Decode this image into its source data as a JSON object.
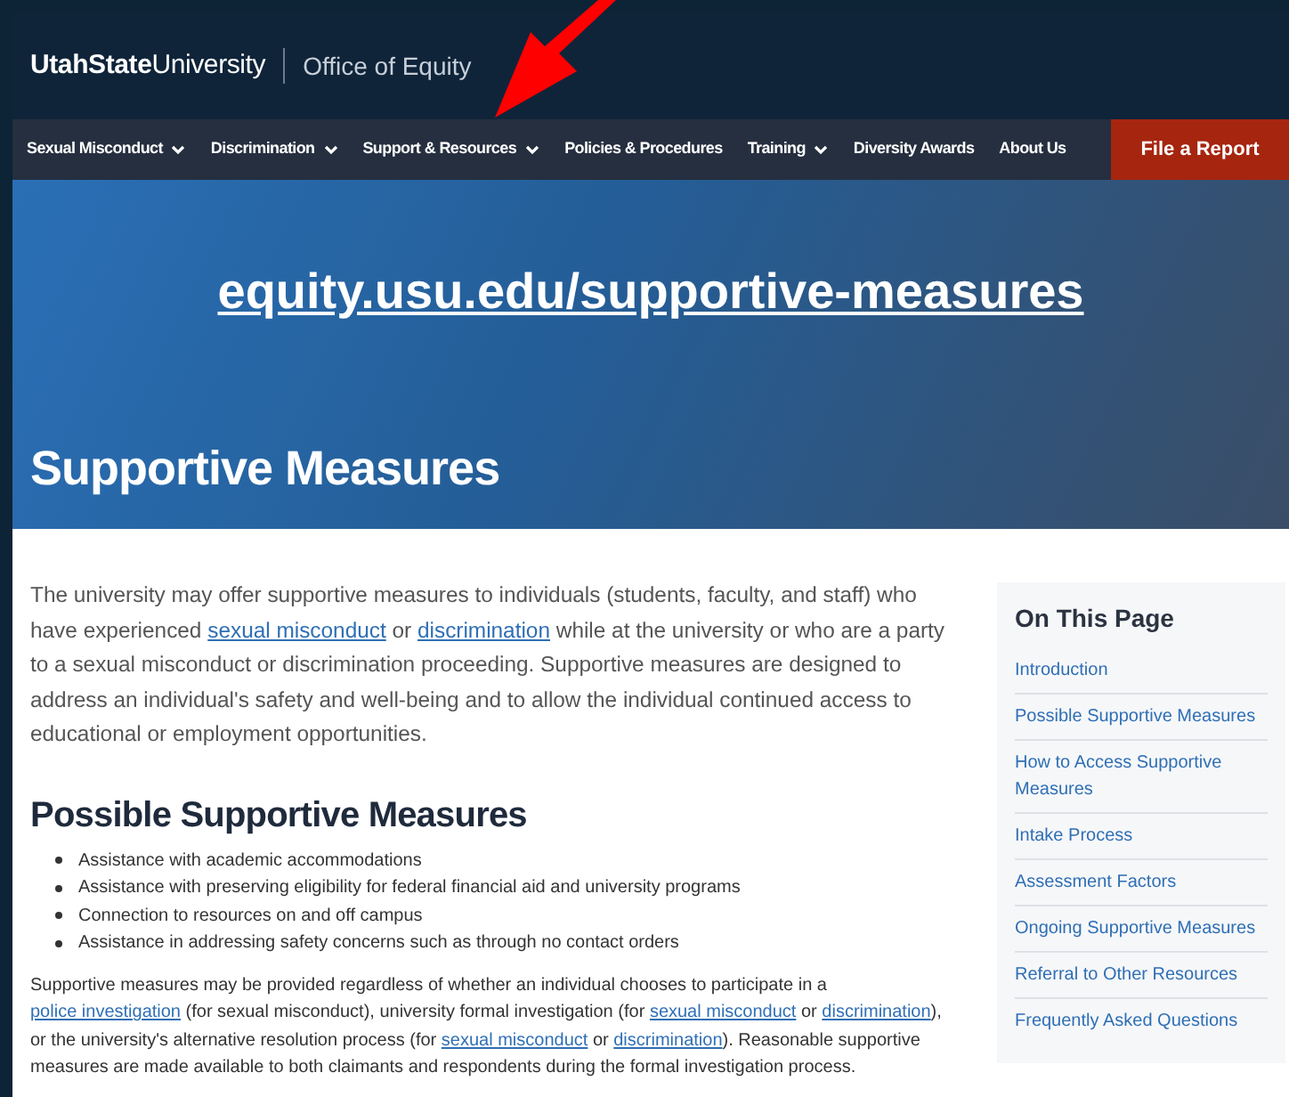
{
  "header": {
    "logo_bold": "UtahState",
    "logo_regular": "University",
    "department": "Office of Equity"
  },
  "annotation_arrow": {
    "color": "#ff0000"
  },
  "nav": {
    "items": [
      {
        "label": "Sexual Misconduct",
        "dropdown": true
      },
      {
        "label": "Discrimination",
        "dropdown": true
      },
      {
        "label": "Support & Resources",
        "dropdown": true
      },
      {
        "label": "Policies & Procedures",
        "dropdown": false
      },
      {
        "label": "Training",
        "dropdown": true
      },
      {
        "label": "Diversity Awards",
        "dropdown": false
      },
      {
        "label": "About Us",
        "dropdown": false
      }
    ],
    "cta": "File a Report"
  },
  "hero": {
    "url": "equity.usu.edu/supportive-measures",
    "title": "Supportive Measures"
  },
  "intro": [
    {
      "kind": "text",
      "text": "The university may offer supportive measures to individuals (students, faculty, and staff) who have experienced "
    },
    {
      "kind": "link",
      "text": "sexual misconduct"
    },
    {
      "kind": "text",
      "text": " or "
    },
    {
      "kind": "link",
      "text": "discrimination"
    },
    {
      "kind": "text",
      "text": " while at the university or who are a party to a sexual misconduct or discrimination proceeding. Supportive measures are designed to address an individual's safety and well-being and to allow the individual continued access to educational or employment opportunities."
    }
  ],
  "section": {
    "heading": "Possible Supportive Measures",
    "bullets": [
      "Assistance with academic accommodations",
      "Assistance with preserving eligibility for federal financial aid and university programs",
      "Connection to resources on and off campus",
      "Assistance in addressing safety concerns such as through no contact orders"
    ],
    "paragraph": [
      {
        "kind": "text",
        "text": "Supportive measures may be provided regardless of whether an individual chooses to participate in a "
      },
      {
        "kind": "link",
        "text": "police investigation"
      },
      {
        "kind": "text",
        "text": " (for sexual misconduct), university formal investigation (for "
      },
      {
        "kind": "link",
        "text": "sexual misconduct"
      },
      {
        "kind": "text",
        "text": " or "
      },
      {
        "kind": "link",
        "text": "discrimination"
      },
      {
        "kind": "text",
        "text": "), or the university's alternative resolution process (for "
      },
      {
        "kind": "link",
        "text": "sexual misconduct"
      },
      {
        "kind": "text",
        "text": " or "
      },
      {
        "kind": "link",
        "text": "discrimination"
      },
      {
        "kind": "text",
        "text": "). Reasonable supportive measures are made available to both claimants and respondents during the formal investigation process."
      }
    ]
  },
  "on_this_page": {
    "title": "On This Page",
    "items": [
      "Introduction",
      "Possible Supportive Measures",
      "How to Access Supportive Measures",
      "Intake Process",
      "Assessment Factors",
      "Ongoing Supportive Measures",
      "Referral to Other Resources",
      "Frequently Asked Questions"
    ]
  }
}
